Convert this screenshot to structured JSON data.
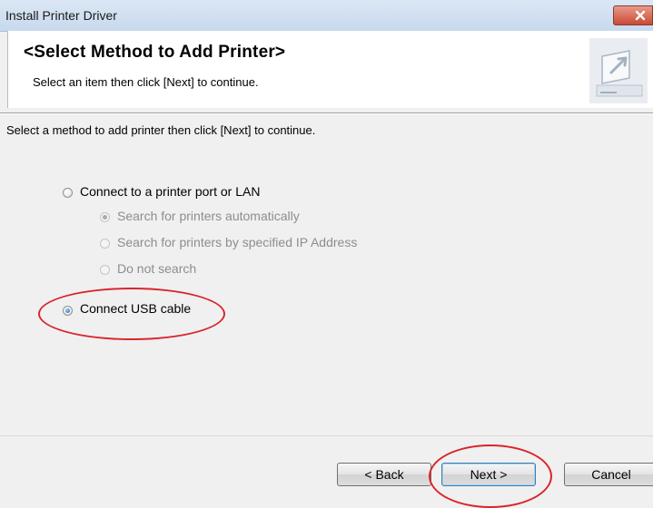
{
  "window": {
    "title": "Install Printer Driver",
    "close_icon": "close-x-icon"
  },
  "header": {
    "title": "<Select Method to Add Printer>",
    "subtitle": "Select an item then click [Next] to continue.",
    "icon": "printer-wizard-icon"
  },
  "instruction": "Select a method to add printer then click [Next] to continue.",
  "options": {
    "port_lan": {
      "label": "Connect to a printer port or LAN",
      "selected": false,
      "enabled": true
    },
    "search_auto": {
      "label": "Search for printers automatically",
      "selected": true,
      "enabled": false
    },
    "search_ip": {
      "label": "Search for printers by specified IP Address",
      "selected": false,
      "enabled": false
    },
    "no_search": {
      "label": "Do not search",
      "selected": false,
      "enabled": false
    },
    "usb": {
      "label": "Connect USB cable",
      "selected": true,
      "enabled": true
    }
  },
  "buttons": {
    "back": "< Back",
    "next": "Next >",
    "cancel": "Cancel"
  },
  "colors": {
    "highlight_oval": "#d8262c",
    "selected_dot": "#1a5fb4"
  }
}
